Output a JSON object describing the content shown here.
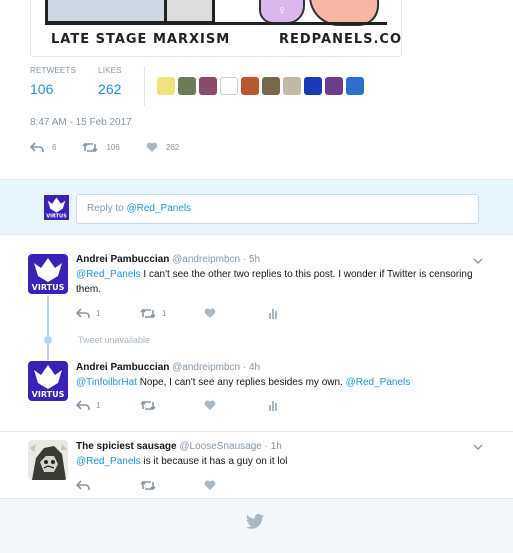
{
  "comic": {
    "caption_left": "LATE STAGE MARXISM",
    "caption_right": "REDPANELS.COM"
  },
  "stats": {
    "retweets_label": "RETWEETS",
    "retweets_value": "106",
    "likes_label": "LIKES",
    "likes_value": "262"
  },
  "timestamp": "8:47 AM - 15 Feb 2017",
  "main_actions": {
    "reply_count": "6",
    "retweet_count": "106",
    "like_count": "262"
  },
  "reply_box": {
    "prefix": "Reply to ",
    "handle": "@Red_Panels"
  },
  "tweets": [
    {
      "name": "Andrei Pambuccian",
      "meta": "@andreipmbcn · 5h",
      "mention": "@Red_Panels",
      "text": " I can't see the other two replies to this post. I wonder if Twitter is censoring them.",
      "reply_count": "1",
      "retweet_count": "1",
      "avatar_text": "VIRTUS"
    },
    {
      "name": "Andrei Pambuccian",
      "meta": "@andreipmbcn · 4h",
      "mention": "@TinfoilbrHat",
      "text": " Nope, I can't see any replies besides my own. ",
      "mention2": "@Red_Panels",
      "reply_count": "1",
      "avatar_text": "VIRTUS"
    },
    {
      "name": "The spiciest sausage",
      "meta": "@LooseSnausage · 1h",
      "mention": "@Red_Panels",
      "text": " is it because it has a guy on it lol"
    }
  ],
  "tweet_unavailable": "Tweet unavailable",
  "colors": {
    "link": "#1b95e0",
    "muted": "#8899a6",
    "virtus_bg": "#3b1fbf",
    "reply_bg": "#e8f5fd"
  },
  "icons": [
    "reply-icon",
    "retweet-icon",
    "heart-icon",
    "analytics-icon",
    "chevron-down-icon",
    "twitter-bird-icon"
  ]
}
